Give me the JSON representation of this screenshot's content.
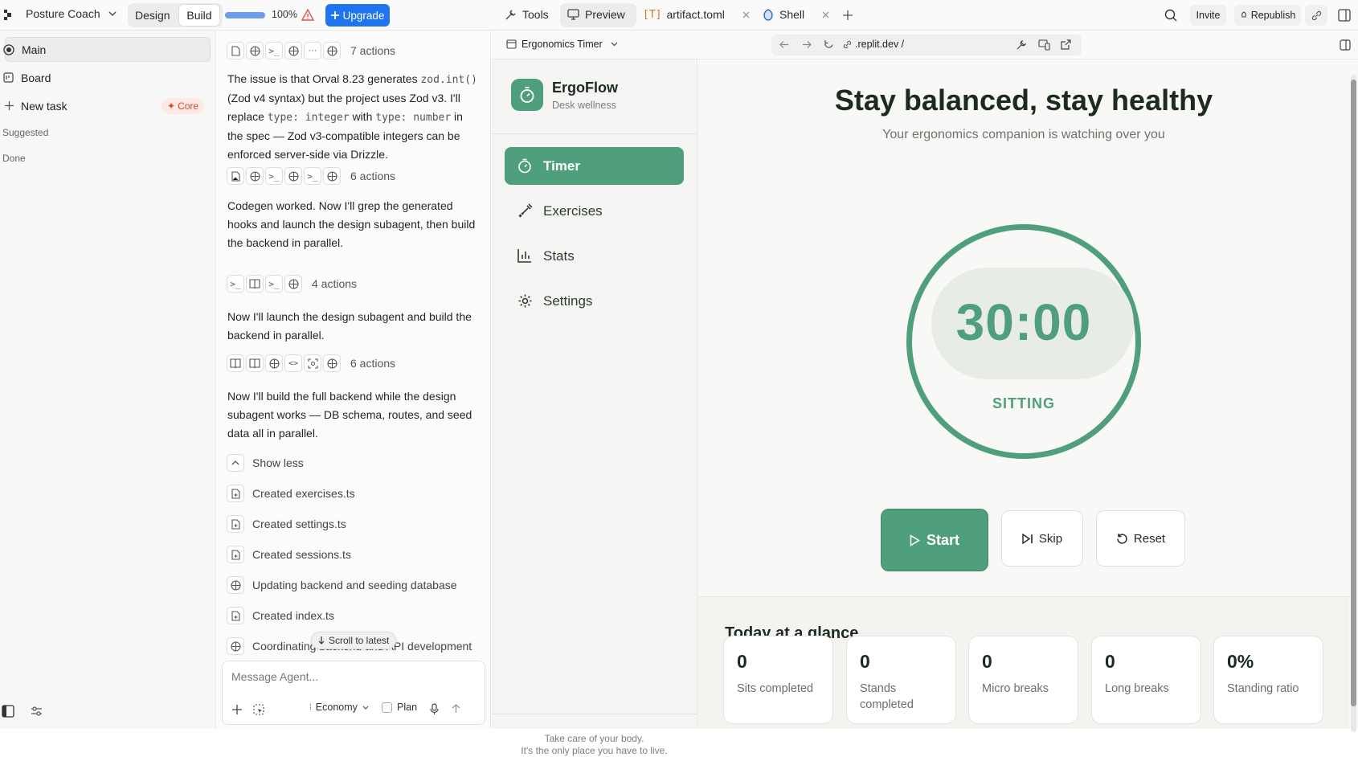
{
  "topbar": {
    "project_name": "Posture Coach",
    "mode_design": "Design",
    "mode_build": "Build",
    "zoom": "100%",
    "upgrade": "Upgrade",
    "tabs": [
      {
        "label": "Tools"
      },
      {
        "label": "Preview"
      },
      {
        "label": "artifact.toml"
      },
      {
        "label": "Shell"
      }
    ],
    "invite": "Invite",
    "republish": "Republish"
  },
  "left": {
    "items": [
      {
        "label": "Main"
      },
      {
        "label": "Board"
      },
      {
        "label": "New task"
      }
    ],
    "core_badge": "Core",
    "suggested": "Suggested",
    "done": "Done"
  },
  "chat": {
    "action_groups": [
      {
        "label": "7 actions"
      },
      {
        "label": "6 actions"
      },
      {
        "label": "4 actions"
      },
      {
        "label": "6 actions"
      }
    ],
    "messages": {
      "m1_a": "The issue is that Orval 8.23 generates ",
      "m1_code1": "zod.int()",
      "m1_b": " (Zod v4 syntax) but the project uses Zod v3. I'll replace ",
      "m1_code2": "type: integer",
      "m1_c": " with ",
      "m1_code3": "type: number",
      "m1_d": " in the spec — Zod v3-compatible integers can be enforced server-side via Drizzle.",
      "m2": "Codegen worked. Now I'll grep the generated hooks and launch the design subagent, then build the backend in parallel.",
      "m3": "Now I'll launch the design subagent and build the backend in parallel.",
      "m4": "Now I'll build the full backend while the design subagent works — DB schema, routes, and seed data all in parallel."
    },
    "show_less": "Show less",
    "files": [
      {
        "label": "Created exercises.ts"
      },
      {
        "label": "Created settings.ts"
      },
      {
        "label": "Created sessions.ts"
      },
      {
        "label": "Updating backend and seeding database"
      },
      {
        "label": "Created index.ts"
      },
      {
        "label": "Coordinating backend and API development"
      }
    ],
    "scroll_latest": "Scroll to latest",
    "input_placeholder": "Message Agent...",
    "model": "Economy",
    "plan": "Plan"
  },
  "preview": {
    "app_selector": "Ergonomics Timer",
    "url": ".replit.dev /"
  },
  "app": {
    "brand": "ErgoFlow",
    "brand_sub": "Desk wellness",
    "nav": [
      {
        "label": "Timer"
      },
      {
        "label": "Exercises"
      },
      {
        "label": "Stats"
      },
      {
        "label": "Settings"
      }
    ],
    "footer_1": "Take care of your body.",
    "footer_2": "It's the only place you have to live.",
    "heading": "Stay balanced, stay healthy",
    "subheading": "Your ergonomics companion is watching over you",
    "timer": "30:00",
    "timer_state": "SITTING",
    "start": "Start",
    "skip": "Skip",
    "reset": "Reset",
    "today_title": "Today at a glance",
    "stats": [
      {
        "num": "0",
        "label": "Sits completed"
      },
      {
        "num": "0",
        "label": "Stands completed"
      },
      {
        "num": "0",
        "label": "Micro breaks"
      },
      {
        "num": "0",
        "label": "Long breaks"
      },
      {
        "num": "0%",
        "label": "Standing ratio"
      }
    ]
  },
  "colors": {
    "accent_green": "#4f9f7c",
    "upgrade_blue": "#1f74f0"
  }
}
